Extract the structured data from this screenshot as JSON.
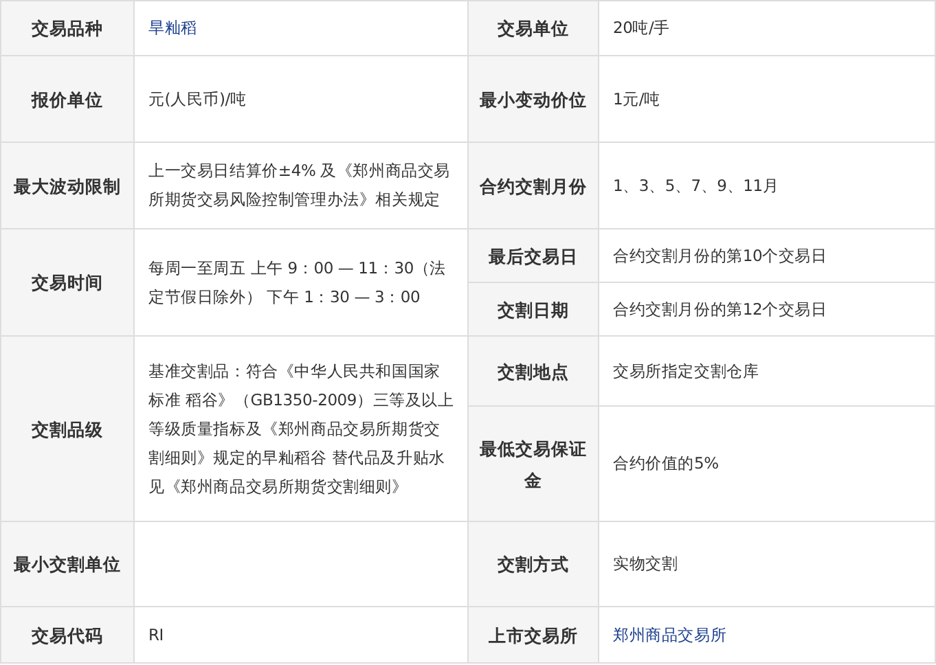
{
  "left": [
    {
      "label": "交易品种",
      "value": "旱籼稻",
      "kind": "link"
    },
    {
      "label": "报价单位",
      "value": "元(人民币)/吨",
      "kind": "text"
    },
    {
      "label": "最大波动限制",
      "value": "上一交易日结算价±4% 及《郑州商品交易所期货交易风险控制管理办法》相关规定",
      "kind": "text"
    },
    {
      "label": "交易时间",
      "value": "每周一至周五 上午 9：00 — 11：30（法定节假日除外） 下午 1：30 — 3：00",
      "kind": "text"
    },
    {
      "label": "交割品级",
      "value": "基准交割品：符合《中华人民共和国国家标准 稻谷》（GB1350-2009）三等及以上等级质量指标及《郑州商品交易所期货交割细则》规定的早籼稻谷 替代品及升贴水见《郑州商品交易所期货交割细则》",
      "kind": "text"
    },
    {
      "label": "最小交割单位",
      "kind": "text"
    },
    {
      "label": "交易代码",
      "value": "RI",
      "kind": "text"
    }
  ],
  "right": [
    {
      "label": "交易单位",
      "value": "20吨/手",
      "kind": "text"
    },
    {
      "label": "最小变动价位",
      "value": "1元/吨",
      "kind": "text"
    },
    {
      "label": "合约交割月份",
      "value": "1、3、5、7、9、11月",
      "kind": "text"
    },
    {
      "label": "最后交易日",
      "value": "合约交割月份的第10个交易日",
      "kind": "text"
    },
    {
      "label": "交割日期",
      "value": "合约交割月份的第12个交易日",
      "kind": "text"
    },
    {
      "label": "交割地点",
      "value": "交易所指定交割仓库",
      "kind": "text"
    },
    {
      "label": "最低交易保证金",
      "value": "合约价值的5%",
      "kind": "text"
    },
    {
      "label": "交割方式",
      "value": "实物交割",
      "kind": "text"
    },
    {
      "label": "上市交易所",
      "value": "郑州商品交易所",
      "kind": "link"
    }
  ]
}
